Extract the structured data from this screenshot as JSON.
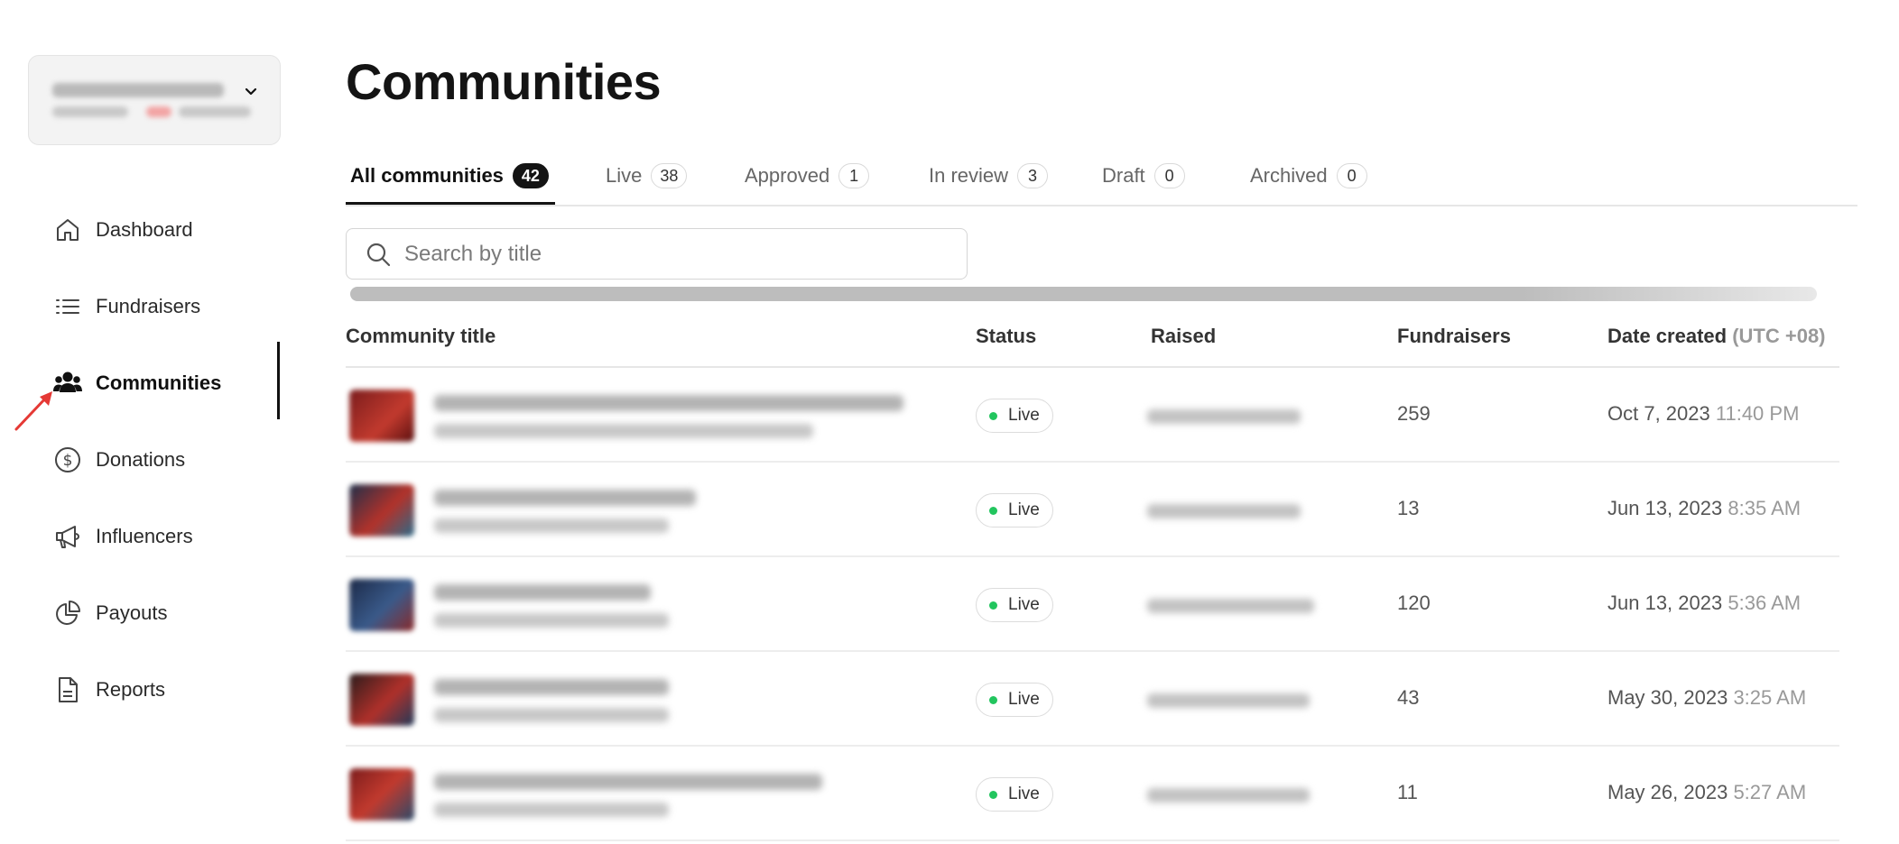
{
  "app": {
    "title": "Communities"
  },
  "org_switcher": {
    "name": "",
    "sub": ""
  },
  "sidebar": {
    "items": [
      {
        "label": "Dashboard",
        "icon": "home-icon",
        "active": false
      },
      {
        "label": "Fundraisers",
        "icon": "list-icon",
        "active": false
      },
      {
        "label": "Communities",
        "icon": "users-icon",
        "active": true
      },
      {
        "label": "Donations",
        "icon": "dollar-circle-icon",
        "active": false
      },
      {
        "label": "Influencers",
        "icon": "megaphone-icon",
        "active": false
      },
      {
        "label": "Payouts",
        "icon": "pie-chart-icon",
        "active": false
      },
      {
        "label": "Reports",
        "icon": "document-icon",
        "active": false
      }
    ]
  },
  "tabs": [
    {
      "label": "All communities",
      "count": "42",
      "active": true
    },
    {
      "label": "Live",
      "count": "38"
    },
    {
      "label": "Approved",
      "count": "1"
    },
    {
      "label": "In review",
      "count": "3"
    },
    {
      "label": "Draft",
      "count": "0"
    },
    {
      "label": "Archived",
      "count": "0"
    }
  ],
  "search": {
    "placeholder": "Search by title"
  },
  "table": {
    "columns": {
      "title": "Community title",
      "status": "Status",
      "raised": "Raised",
      "fundraisers": "Fundraisers",
      "date": "Date created",
      "date_tz": "(UTC +08)"
    },
    "rows": [
      {
        "status": "Live",
        "fundraisers": "259",
        "date": "Oct 7, 2023",
        "time": "11:40 PM"
      },
      {
        "status": "Live",
        "fundraisers": "13",
        "date": "Jun 13, 2023",
        "time": "8:35 AM"
      },
      {
        "status": "Live",
        "fundraisers": "120",
        "date": "Jun 13, 2023",
        "time": "5:36 AM"
      },
      {
        "status": "Live",
        "fundraisers": "43",
        "date": "May 30, 2023",
        "time": "3:25 AM"
      },
      {
        "status": "Live",
        "fundraisers": "11",
        "date": "May 26, 2023",
        "time": "5:27 AM"
      }
    ]
  },
  "colors": {
    "live_dot": "#22c55e",
    "accent": "#141414",
    "arrow": "#e53935"
  }
}
